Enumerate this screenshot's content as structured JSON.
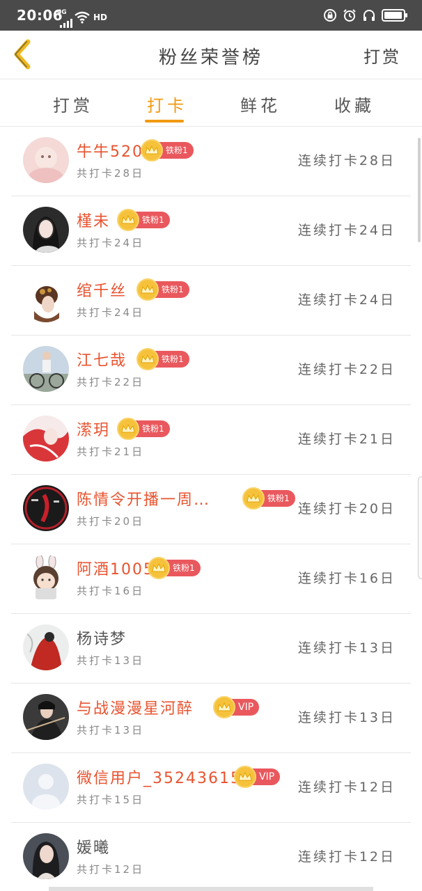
{
  "status_bar": {
    "time": "20:06",
    "network": "4G",
    "hd_label": "HD",
    "battery_level": 0.95
  },
  "header": {
    "title": "粉丝荣誉榜",
    "action_label": "打赏"
  },
  "tabs": [
    {
      "label": "打赏",
      "active": false
    },
    {
      "label": "打卡",
      "active": true
    },
    {
      "label": "鲜花",
      "active": false
    },
    {
      "label": "收藏",
      "active": false
    }
  ],
  "colors": {
    "accent": "#f29a12",
    "name_highlight": "#e8532f",
    "badge_red": "#e9585d",
    "badge_gold": "#f6c23c"
  },
  "rows": [
    {
      "name": "牛牛520",
      "badge": "铁粉1",
      "total": "共打卡28日",
      "streak": "连续打卡28日",
      "highlight": true,
      "avatar": "baby-photo"
    },
    {
      "name": "槿未",
      "badge": "铁粉1",
      "total": "共打卡24日",
      "streak": "连续打卡24日",
      "highlight": true,
      "avatar": "girl-portrait"
    },
    {
      "name": "绾千丝",
      "badge": "铁粉1",
      "total": "共打卡24日",
      "streak": "连续打卡24日",
      "highlight": true,
      "avatar": "hair-ornament"
    },
    {
      "name": "江七哉",
      "badge": "铁粉1",
      "total": "共打卡22日",
      "streak": "连续打卡22日",
      "highlight": true,
      "avatar": "bike-rider"
    },
    {
      "name": "潆玥",
      "badge": "铁粉1",
      "total": "共打卡21日",
      "streak": "连续打卡21日",
      "highlight": true,
      "avatar": "red-art"
    },
    {
      "name": "陈情令开播一周…",
      "badge": "铁粉1",
      "total": "共打卡20日",
      "streak": "连续打卡20日",
      "highlight": true,
      "avatar": "drama-poster"
    },
    {
      "name": "阿酒1005",
      "badge": "铁粉1",
      "total": "共打卡16日",
      "streak": "连续打卡16日",
      "highlight": true,
      "avatar": "bunny-cartoon"
    },
    {
      "name": "杨诗梦",
      "badge": "",
      "total": "共打卡13日",
      "streak": "连续打卡13日",
      "highlight": false,
      "avatar": "red-cloak"
    },
    {
      "name": "与战漫漫星河醉",
      "badge": "VIP",
      "total": "共打卡13日",
      "streak": "连续打卡13日",
      "highlight": true,
      "avatar": "swordsman"
    },
    {
      "name": "微信用户_352436156",
      "badge": "VIP",
      "total": "共打卡15日",
      "streak": "连续打卡12日",
      "highlight": true,
      "avatar": "default-user"
    },
    {
      "name": "媛曦",
      "badge": "",
      "total": "共打卡12日",
      "streak": "连续打卡12日",
      "highlight": false,
      "avatar": "woman-portrait"
    }
  ]
}
